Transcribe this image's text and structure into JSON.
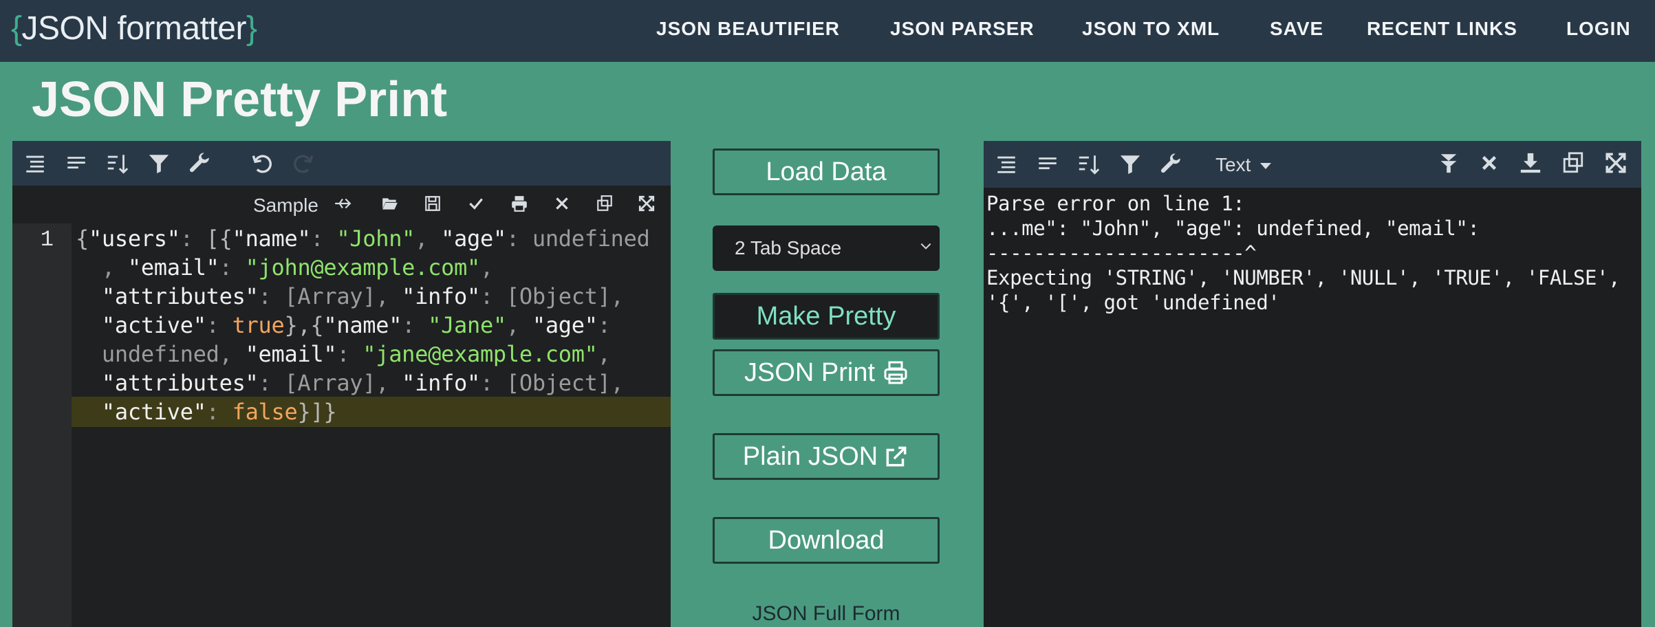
{
  "header": {
    "logo_open": "{",
    "logo_text": "JSON formatter",
    "logo_close": "}",
    "nav": [
      "JSON BEAUTIFIER",
      "JSON PARSER",
      "JSON TO XML",
      "SAVE",
      "RECENT LINKS",
      "LOGIN"
    ]
  },
  "page_title": "JSON Pretty Print",
  "left_editor": {
    "sample_label": "Sample",
    "line_number": "1",
    "code_lines": [
      "{\"users\": [{\"name\": \"John\", \"age\": undefined",
      ", \"email\": \"john@example.com\",",
      "\"attributes\": [Array], \"info\": [Object],",
      "\"active\": true},{\"name\": \"Jane\", \"age\":",
      "undefined, \"email\": \"jane@example.com\",",
      "\"attributes\": [Array], \"info\": [Object],",
      "\"active\": false}]}"
    ]
  },
  "controls": {
    "load_data": "Load Data",
    "tab_space": "2 Tab Space",
    "make_pretty": "Make Pretty",
    "json_print": "JSON Print",
    "plain_json": "Plain JSON",
    "download": "Download",
    "full_form": "JSON Full Form"
  },
  "right_output": {
    "mode": "Text",
    "lines": [
      "Parse error on line 1:",
      "...me\": \"John\", \"age\": undefined, \"email\":",
      "----------------------^",
      "Expecting 'STRING', 'NUMBER', 'NULL', 'TRUE', 'FALSE',",
      "'{', '[', got 'undefined'"
    ]
  },
  "colors": {
    "accent": "#4a9a80",
    "nav_bg": "#293847",
    "editor_bg": "#1e2022"
  },
  "icons": {
    "left_toolbar": [
      "format-icon",
      "compact-icon",
      "sort-icon",
      "filter-icon",
      "wrench-icon",
      "undo-icon",
      "redo-icon"
    ],
    "left_subbar": [
      "share-icon",
      "folder-open-icon",
      "save-icon",
      "check-icon",
      "print-icon",
      "close-icon",
      "copy-icon",
      "expand-icon"
    ],
    "right_toolbar": [
      "format-icon",
      "compact-icon",
      "sort-icon",
      "filter-icon",
      "wrench-icon",
      "collapse-all-icon",
      "close-icon",
      "download-icon",
      "copy-icon",
      "expand-icon"
    ]
  }
}
